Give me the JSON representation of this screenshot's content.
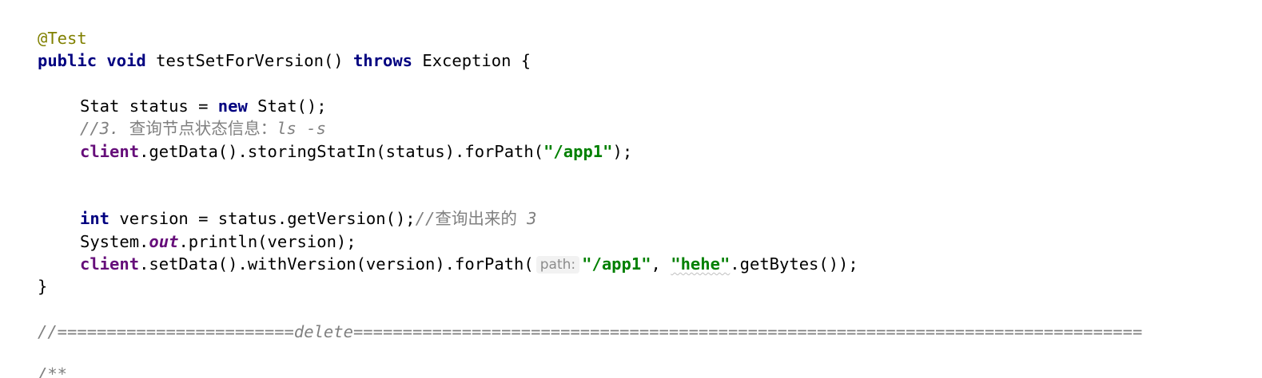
{
  "code": {
    "annotation": "@Test",
    "method_signature": {
      "kw_public": "public",
      "kw_void": "void",
      "name": "testSetForVersion()",
      "kw_throws": "throws",
      "exception": "Exception {"
    },
    "stat_line": {
      "decl": "Stat status = ",
      "kw_new": "new",
      "ctor": " Stat();"
    },
    "comment_query": {
      "prefix": "//3. ",
      "cn": "查询节点状态信息：",
      "suffix": "ls -s"
    },
    "getdata_line": {
      "client": "client",
      "call": ".getData().storingStatIn(status).forPath(",
      "path": "\"/app1\"",
      "end": ");"
    },
    "version_line": {
      "kw_int": "int",
      "rest": " version = status.getVersion();",
      "comment_prefix": "//",
      "comment_cn": "查询出来的",
      "comment_num": " 3"
    },
    "println_line": {
      "system": "System.",
      "out": "out",
      "rest": ".println(version);"
    },
    "setdata_line": {
      "client": "client",
      "call": ".setData().withVersion(version).forPath(",
      "hint": "path:",
      "path": "\"/app1\"",
      "comma": ", ",
      "data": "\"hehe\"",
      "end": ".getBytes());"
    },
    "close_brace": "}",
    "separator": "//========================delete================================================================================",
    "javadoc_start": "/**"
  }
}
